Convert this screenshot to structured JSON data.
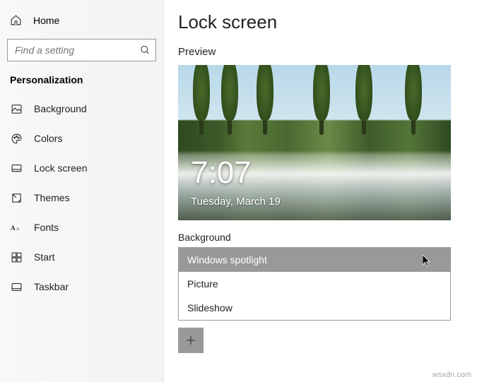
{
  "sidebar": {
    "home_label": "Home",
    "search_placeholder": "Find a setting",
    "section_title": "Personalization",
    "items": [
      {
        "label": "Background"
      },
      {
        "label": "Colors"
      },
      {
        "label": "Lock screen"
      },
      {
        "label": "Themes"
      },
      {
        "label": "Fonts"
      },
      {
        "label": "Start"
      },
      {
        "label": "Taskbar"
      }
    ]
  },
  "main": {
    "title": "Lock screen",
    "preview_label": "Preview",
    "preview_time": "7:07",
    "preview_date": "Tuesday, March 19",
    "background_label": "Background",
    "dropdown_options": [
      "Windows spotlight",
      "Picture",
      "Slideshow"
    ],
    "selected_option": "Windows spotlight"
  },
  "watermark": "wsxdn.com"
}
